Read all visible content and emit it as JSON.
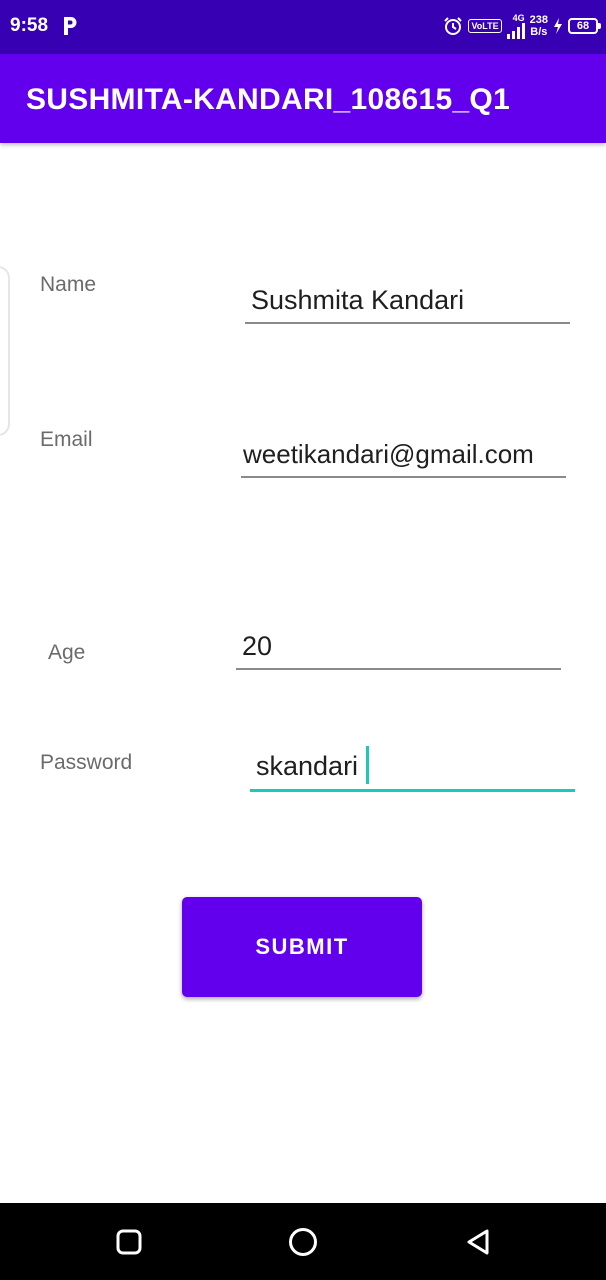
{
  "status_bar": {
    "time": "9:58",
    "left_icon": "p-icon",
    "icons": [
      "alarm-icon",
      "volte-icon",
      "signal-icon",
      "charging-icon",
      "battery-icon"
    ],
    "volte": "VoLTE",
    "network": "4G",
    "speed_value": "238",
    "speed_unit": "B/s",
    "battery": "68"
  },
  "app_bar": {
    "title": "SUSHMITA-KANDARI_108615_Q1",
    "color": "#6200ee"
  },
  "form": {
    "name": {
      "label": "Name",
      "value": "Sushmita Kandari"
    },
    "email": {
      "label": "Email",
      "value": "weetikandari@gmail.com"
    },
    "age": {
      "label": "Age",
      "value": "20"
    },
    "password": {
      "label": "Password",
      "value": "skandari"
    }
  },
  "submit": {
    "label": "SUBMIT"
  },
  "nav_bar": {
    "icons": [
      "recents-icon",
      "home-icon",
      "back-icon"
    ]
  },
  "colors": {
    "status_bar": "#3700b3",
    "primary": "#6200ee",
    "accent": "#19c9b9"
  }
}
